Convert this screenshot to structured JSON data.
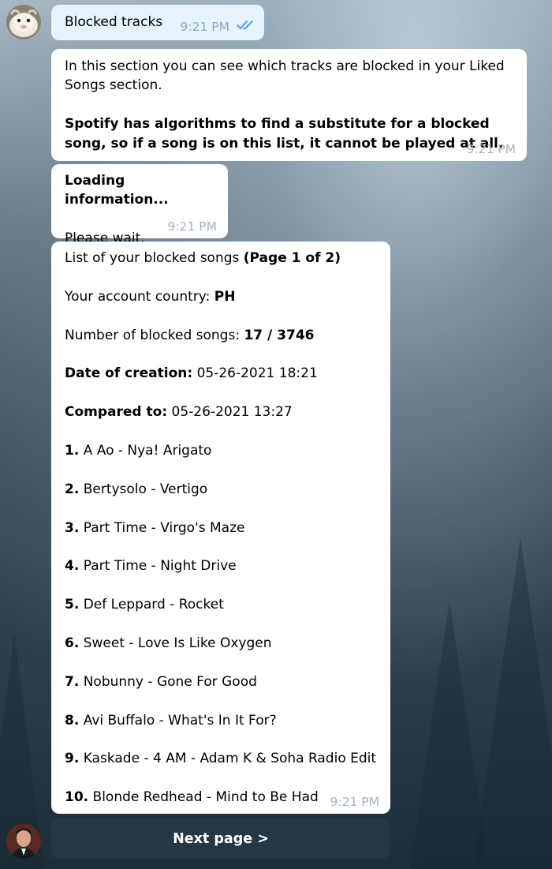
{
  "outgoing": {
    "text": "Blocked tracks",
    "time": "9:21 PM"
  },
  "message1": {
    "line1": "In this section you can see which tracks are blocked in your Liked Songs section.",
    "line2": "Spotify has algorithms to find a substitute for a blocked song, so if a song is on this list, it cannot be played at all.",
    "time": "9:21 PM"
  },
  "message2": {
    "heading": "Loading information...",
    "body": "Please wait.",
    "time": "9:21 PM"
  },
  "message3": {
    "list_title": "List of your blocked songs",
    "page_info": "(Page 1 of 2)",
    "country_label": "Your account country:",
    "country_value": "PH",
    "count_label": "Number of blocked songs:",
    "count_value": "17 / 3746",
    "created_label": "Date of creation:",
    "created_value": "05-26-2021 18:21",
    "compared_label": "Compared to:",
    "compared_value": "05-26-2021 13:27",
    "songs": [
      {
        "num": "1.",
        "title": "A Ao - Nya! Arigato"
      },
      {
        "num": "2.",
        "title": "Bertysolo - Vertigo"
      },
      {
        "num": "3.",
        "title": "Part Time - Virgo's Maze"
      },
      {
        "num": "4.",
        "title": "Part Time - Night Drive"
      },
      {
        "num": "5.",
        "title": "Def Leppard - Rocket"
      },
      {
        "num": "6.",
        "title": "Sweet - Love Is Like Oxygen"
      },
      {
        "num": "7.",
        "title": "Nobunny - Gone For Good"
      },
      {
        "num": "8.",
        "title": "Avi Buffalo - What's In It For?"
      },
      {
        "num": "9.",
        "title": "Kaskade - 4 AM - Adam K & Soha Radio Edit"
      },
      {
        "num": "10.",
        "title": "Blonde Redhead - Mind to Be Had"
      }
    ],
    "time": "9:21 PM"
  },
  "button": {
    "label": "Next page >"
  },
  "colors": {
    "bubble": "#ffffff",
    "outgoing_bubble": "#e6f3fd",
    "timestamp": "#a6b3be",
    "read_check": "#4ca3dd",
    "button_bg": "#283a46"
  },
  "icons": {
    "read_receipt": "double-check-icon"
  }
}
